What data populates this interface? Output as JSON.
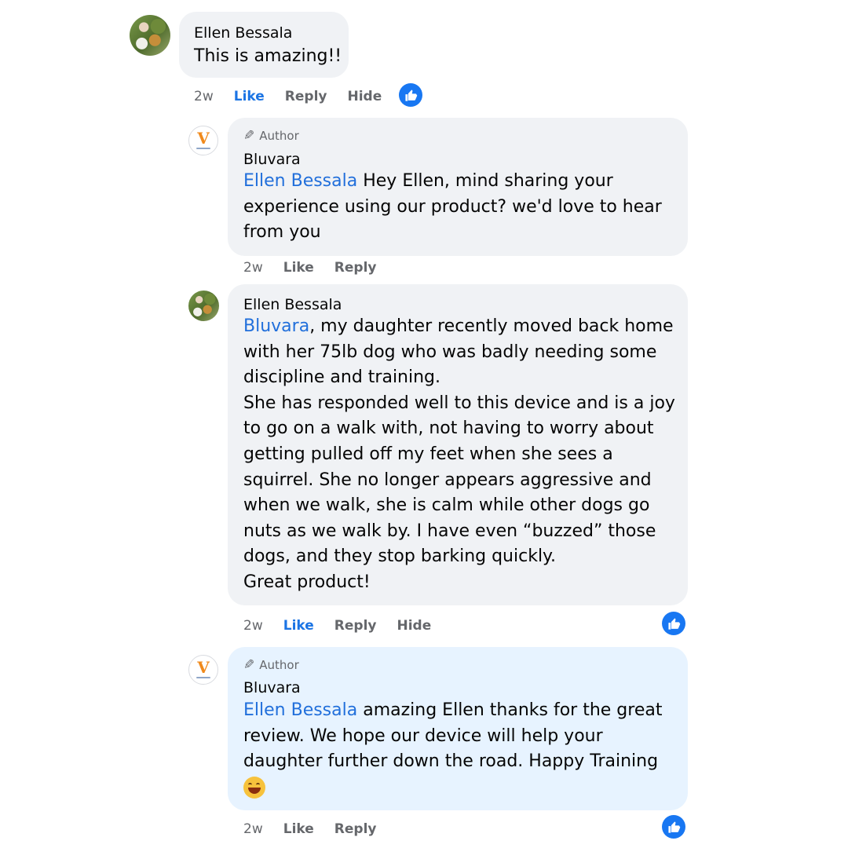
{
  "comment1": {
    "name": "Ellen Bessala",
    "text": "This is amazing!!",
    "time": "2w",
    "actions": {
      "like": "Like",
      "reply": "Reply",
      "hide": "Hide"
    },
    "liked": true,
    "reaction_icon": "like-reaction-icon"
  },
  "reply1": {
    "badge": "Author",
    "name": "Bluvara",
    "mention": "Ellen Bessala",
    "lines": [
      " Hey Ellen, mind sharing your",
      "experience using our product? we'd love to hear",
      "from you"
    ],
    "time": "2w",
    "actions": {
      "like": "Like",
      "reply": "Reply"
    }
  },
  "reply2": {
    "name": "Ellen Bessala",
    "mention": "Bluvara",
    "lines": [
      ", my daughter recently moved back home",
      "with her 75lb dog who was badly needing some",
      "discipline and training.",
      "She has responded well to this device and is a joy",
      "to go on a walk with, not having to worry about",
      "getting pulled off my feet when she sees a",
      "squirrel. She no longer appears aggressive and",
      "when we walk, she is calm while other dogs go",
      "nuts as we walk by. I have even “buzzed” those",
      "dogs, and they stop barking quickly.",
      "Great product!"
    ],
    "time": "2w",
    "actions": {
      "like": "Like",
      "reply": "Reply",
      "hide": "Hide"
    },
    "liked": true,
    "reaction_icon": "like-reaction-icon"
  },
  "reply3": {
    "badge": "Author",
    "name": "Bluvara",
    "mention": "Ellen Bessala",
    "lines": [
      " amazing Ellen thanks for the great",
      "review. We hope our device will help your",
      "daughter further down the road. Happy Training"
    ],
    "emoji": "grinning-face-emoji",
    "time": "2w",
    "actions": {
      "like": "Like",
      "reply": "Reply"
    },
    "reaction_icon": "like-reaction-icon"
  },
  "logo_text": "V",
  "colors": {
    "mention": "#216fdb",
    "like_active": "#1b74e4",
    "bubble": "#f0f2f5",
    "bubble_highlight": "#e7f3ff",
    "reaction": "#1877f2"
  }
}
